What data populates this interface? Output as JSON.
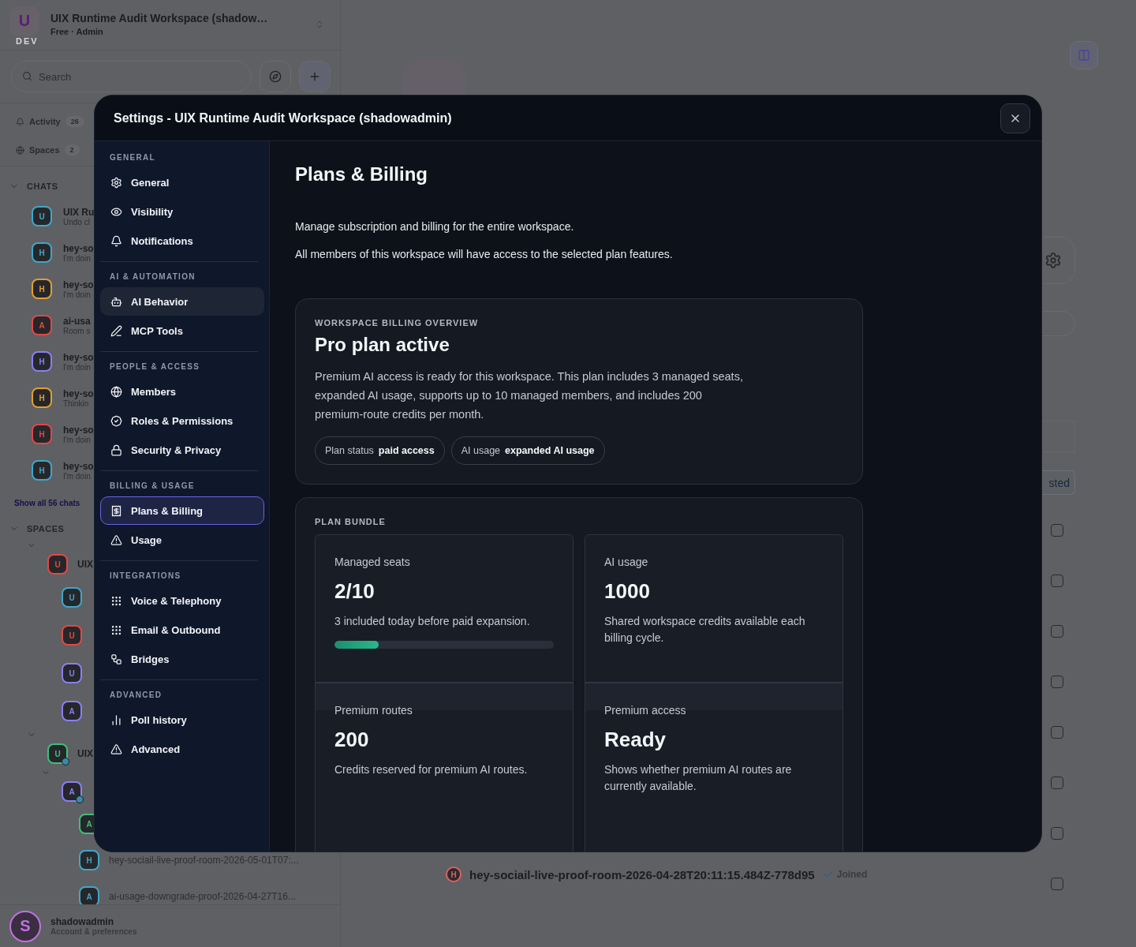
{
  "workspace": {
    "logo_letter": "U",
    "env_label": "DEV",
    "name": "UIX Runtime Audit Workspace (shadow…",
    "plan": "Free · Admin"
  },
  "search": {
    "placeholder": "Search"
  },
  "nav": [
    {
      "label": "Activity",
      "count": "26"
    },
    {
      "label": "Spaces",
      "count": "2"
    }
  ],
  "chats": {
    "title": "CHATS",
    "expanded": true,
    "show_all": "Show all 56 chats",
    "items": [
      {
        "letter": "U",
        "color": "#3fa7c9",
        "title": "UIX Ru",
        "preview": "Undo cl"
      },
      {
        "letter": "H",
        "color": "#3fa7c9",
        "title": "hey-so",
        "preview": "I'm doin"
      },
      {
        "letter": "H",
        "color": "#e0a030",
        "title": "hey-so",
        "preview": "I'm doin"
      },
      {
        "letter": "A",
        "color": "#e04848",
        "title": "ai-usa",
        "preview": "Room s"
      },
      {
        "letter": "H",
        "color": "#8a7ef5",
        "title": "hey-so",
        "preview": "I'm doin"
      },
      {
        "letter": "H",
        "color": "#e0a030",
        "title": "hey-so",
        "preview": "Thinkin"
      },
      {
        "letter": "H",
        "color": "#e04848",
        "title": "hey-so",
        "preview": "I'm doin"
      },
      {
        "letter": "H",
        "color": "#3fa7c9",
        "title": "hey-so",
        "preview": "I'm doin"
      }
    ]
  },
  "spaces": {
    "title": "SPACES",
    "expanded": true,
    "items": [
      {
        "letter": "U",
        "color": "#e04848",
        "name": "UIX",
        "expanded": true,
        "children": [
          {
            "letter": "U",
            "color": "#3fa7c9"
          },
          {
            "letter": "U",
            "color": "#e04848"
          },
          {
            "letter": "U",
            "color": "#8a7ef5"
          },
          {
            "letter": "A",
            "color": "#8a7ef5"
          }
        ]
      },
      {
        "letter": "U",
        "color": "#3fbf7a",
        "name": "UIX",
        "expanded": true,
        "online": true,
        "children": [
          {
            "letter": "A",
            "color": "#8a7ef5",
            "expanded": true,
            "online": true,
            "children": [
              {
                "letter": "A",
                "color": "#3fbf7a"
              },
              {
                "letter": "H",
                "color": "#3fa7c9",
                "name": "hey-sociail-live-proof-room-2026-05-01T07:..."
              },
              {
                "letter": "A",
                "color": "#3fa7c9",
                "name": "ai-usage-downgrade-proof-2026-04-27T16..."
              }
            ]
          }
        ]
      }
    ]
  },
  "account": {
    "letter": "S",
    "name": "shadowadmin",
    "subtitle": "Account & preferences"
  },
  "main": {
    "cut_button": "sted",
    "checkboxes": [
      {
        "checked": false
      },
      {
        "checked": false
      },
      {
        "checked": false
      },
      {
        "checked": false
      },
      {
        "checked": false
      },
      {
        "checked": false
      },
      {
        "checked": false
      },
      {
        "checked": false
      }
    ],
    "room": {
      "letter": "H",
      "name": "hey-sociail-live-proof-room-2026-04-28T20:11:15.484Z-778d95",
      "status": "Joined"
    }
  },
  "settings": {
    "title": "Settings - UIX Runtime Audit Workspace (shadowadmin)",
    "groups": [
      {
        "title": "GENERAL",
        "items": [
          {
            "label": "General",
            "selected": false,
            "hovered": false
          },
          {
            "label": "Visibility",
            "selected": false,
            "hovered": false
          },
          {
            "label": "Notifications",
            "selected": false,
            "hovered": false
          }
        ]
      },
      {
        "title": "AI & AUTOMATION",
        "items": [
          {
            "label": "AI Behavior",
            "selected": false,
            "hovered": true
          },
          {
            "label": "MCP Tools",
            "selected": false,
            "hovered": false
          }
        ]
      },
      {
        "title": "PEOPLE & ACCESS",
        "items": [
          {
            "label": "Members",
            "selected": false,
            "hovered": false
          },
          {
            "label": "Roles & Permissions",
            "selected": false,
            "hovered": false
          },
          {
            "label": "Security & Privacy",
            "selected": false,
            "hovered": false
          }
        ]
      },
      {
        "title": "BILLING & USAGE",
        "items": [
          {
            "label": "Plans & Billing",
            "selected": true,
            "hovered": false
          },
          {
            "label": "Usage",
            "selected": false,
            "hovered": false
          }
        ]
      },
      {
        "title": "INTEGRATIONS",
        "items": [
          {
            "label": "Voice & Telephony",
            "selected": false,
            "hovered": false
          },
          {
            "label": "Email & Outbound",
            "selected": false,
            "hovered": false
          },
          {
            "label": "Bridges",
            "selected": false,
            "hovered": false
          }
        ]
      },
      {
        "title": "ADVANCED",
        "items": [
          {
            "label": "Poll history",
            "selected": false,
            "hovered": false
          },
          {
            "label": "Advanced",
            "selected": false,
            "hovered": false
          }
        ]
      }
    ],
    "page": {
      "heading": "Plans & Billing",
      "paragraphs": [
        "Manage subscription and billing for the entire workspace.",
        "All members of this workspace will have access to the selected plan features."
      ],
      "overview": {
        "eyebrow": "WORKSPACE BILLING OVERVIEW",
        "title": "Pro plan active",
        "description": "Premium AI access is ready for this workspace. This plan includes 3 managed seats, expanded AI usage, supports up to 10 managed members, and includes 200 premium-route credits per month.",
        "chips": [
          {
            "label": "Plan status",
            "value": "paid access"
          },
          {
            "label": "AI usage",
            "value": "expanded AI usage"
          }
        ]
      },
      "bundle": {
        "title": "PLAN BUNDLE",
        "stats": [
          {
            "label": "Managed seats",
            "value": "2/10",
            "note": "3 included today before paid expansion.",
            "level": 0.2
          },
          {
            "label": "AI usage",
            "value": "1000",
            "note": "Shared workspace credits available each billing cycle."
          },
          {
            "label": "Premium routes",
            "value": "200",
            "note": "Credits reserved for premium AI routes."
          },
          {
            "label": "Premium access",
            "value": "Ready",
            "note": "Shows whether premium AI routes are currently available."
          }
        ]
      }
    }
  }
}
